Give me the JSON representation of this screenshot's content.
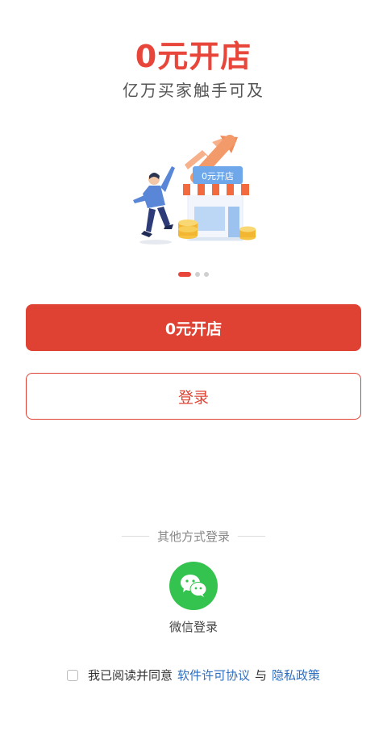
{
  "hero": {
    "title": "0元开店",
    "subtitle": "亿万买家触手可及"
  },
  "illustration": {
    "store_sign": "0元开店",
    "icon": "open-store-illustration"
  },
  "carousel": {
    "current_page": 1,
    "total_pages": 3
  },
  "buttons": {
    "open_store": "0元开店",
    "login": "登录"
  },
  "other_login": {
    "label": "其他方式登录",
    "wechat_label": "微信登录",
    "wechat_icon": "wechat-icon"
  },
  "agreement": {
    "prefix": "我已阅读并同意",
    "license_link": "软件许可协议",
    "conjunction": "与",
    "privacy_link": "隐私政策"
  },
  "colors": {
    "accent": "#DF4233",
    "wechat": "#35C34F",
    "link": "#2F6FC0"
  }
}
